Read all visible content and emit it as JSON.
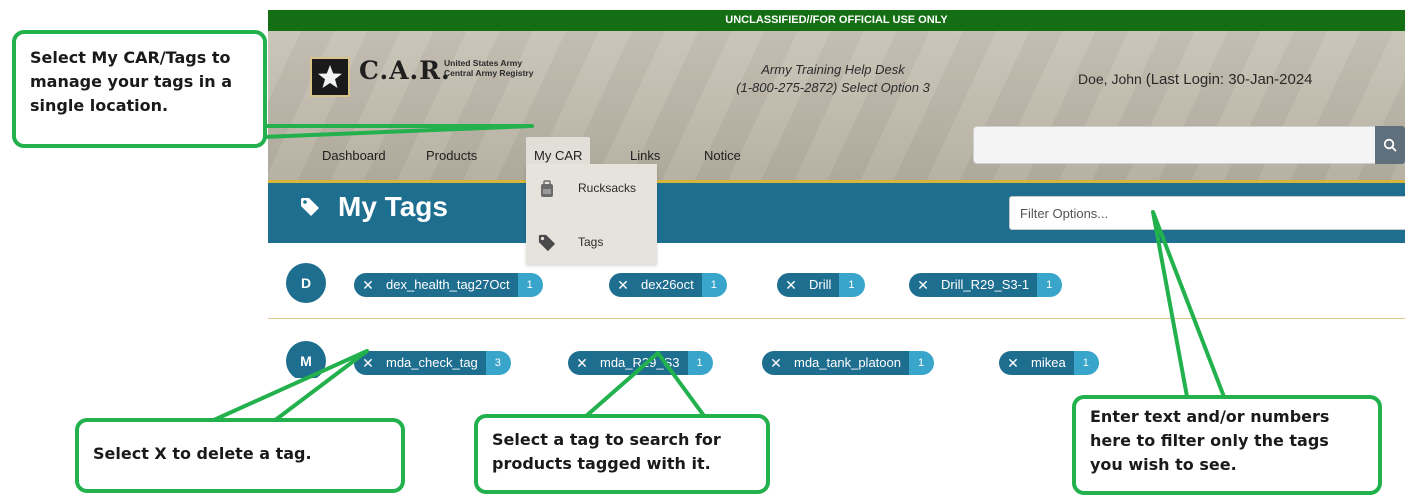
{
  "banner": "UNCLASSIFIED//FOR OFFICIAL USE ONLY",
  "logo": {
    "text": "C.A.R.",
    "subtitle_line1": "United States Army",
    "subtitle_line2": "Central Army Registry"
  },
  "helpdesk": {
    "line1": "Army Training Help Desk",
    "line2": "(1-800-275-2872) Select Option 3"
  },
  "user": {
    "name": "Doe, John",
    "last_login": "(Last Login: 30-Jan-2024"
  },
  "nav": {
    "dashboard": "Dashboard",
    "products": "Products",
    "mycar": "My CAR",
    "links": "Links",
    "notice": "Notice"
  },
  "search": {
    "placeholder": ""
  },
  "dropdown": {
    "rucksacks": "Rucksacks",
    "tags": "Tags"
  },
  "page_title": "My Tags",
  "filter": {
    "placeholder": "Filter Options..."
  },
  "groups": [
    {
      "letter": "D",
      "tags": [
        {
          "name": "dex_health_tag27Oct",
          "count": "1"
        },
        {
          "name": "dex26oct",
          "count": "1"
        },
        {
          "name": "Drill",
          "count": "1"
        },
        {
          "name": "Drill_R29_S3-1",
          "count": "1"
        }
      ]
    },
    {
      "letter": "M",
      "tags": [
        {
          "name": "mda_check_tag",
          "count": "3"
        },
        {
          "name": "mda_R29_S3",
          "count": "1"
        },
        {
          "name": "mda_tank_platoon",
          "count": "1"
        },
        {
          "name": "mikea",
          "count": "1"
        }
      ]
    }
  ],
  "callouts": {
    "mycar": "Select My CAR/Tags to manage your tags in a single location.",
    "delete": "Select X to delete a tag.",
    "search": "Select a tag to search for products tagged with it.",
    "filter": "Enter text and/or numbers here to filter only the tags you wish to see."
  },
  "colors": {
    "banner": "#146e14",
    "primary": "#1e6e90",
    "count": "#3aa5cb",
    "callout_border": "#22b14c",
    "accent_line": "#d7b43a"
  },
  "icons": {
    "close": "close-icon",
    "tag": "tag-icon",
    "search": "search-icon",
    "rucksack": "rucksack-icon",
    "star": "army-star-icon"
  }
}
